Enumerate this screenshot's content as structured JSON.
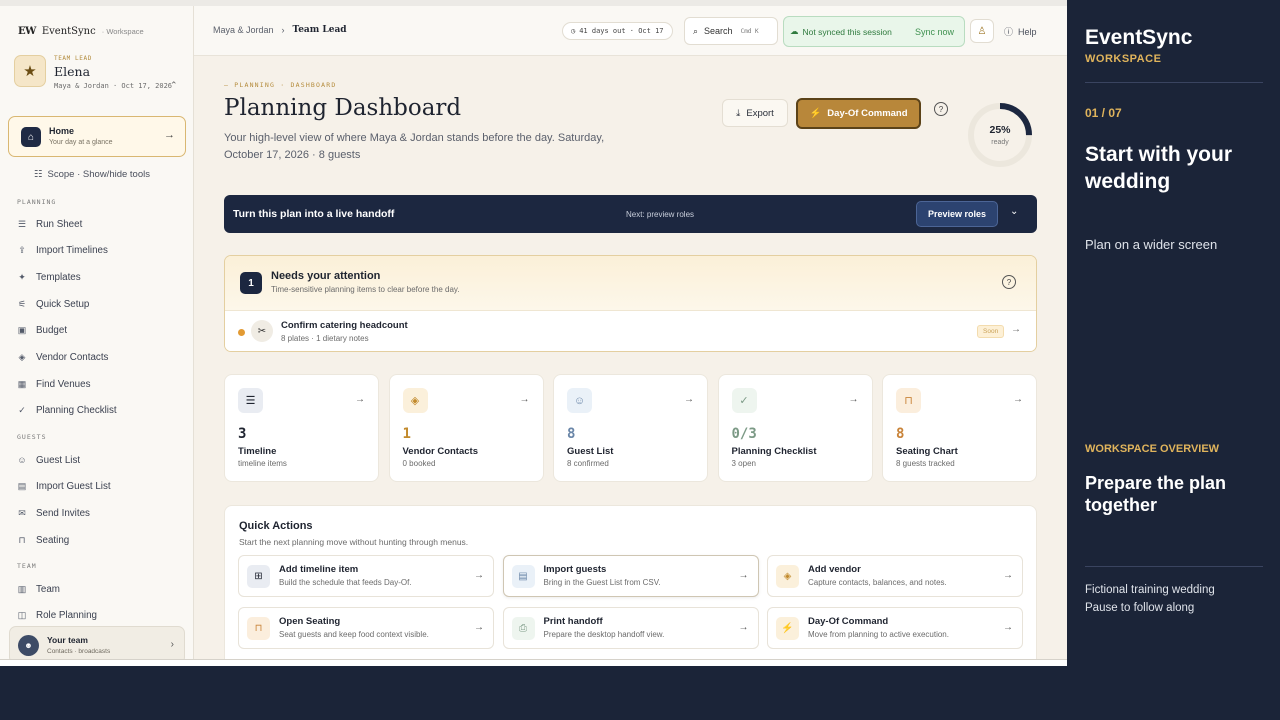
{
  "brand": {
    "logo": "EW",
    "name": "EventSync",
    "sub": "· Workspace"
  },
  "user": {
    "role": "TEAM LEAD",
    "name": "Elena",
    "meta": "Maya & Jordan · Oct 17, 2026",
    "switch_icon": "⌃"
  },
  "home": {
    "title": "Home",
    "sub": "Your day at a glance"
  },
  "scope": {
    "label": "Scope · Show/hide tools"
  },
  "sections": {
    "planning": "PLANNING",
    "guests": "GUESTS",
    "team": "TEAM"
  },
  "nav_planning": [
    {
      "label": "Run Sheet",
      "icon": "☰"
    },
    {
      "label": "Import Timelines",
      "icon": "⇪"
    },
    {
      "label": "Templates",
      "icon": "✦"
    },
    {
      "label": "Quick Setup",
      "icon": "⚟"
    },
    {
      "label": "Budget",
      "icon": "▣"
    },
    {
      "label": "Vendor Contacts",
      "icon": "◈"
    },
    {
      "label": "Find Venues",
      "icon": "▦"
    },
    {
      "label": "Planning Checklist",
      "icon": "✓"
    }
  ],
  "nav_guests": [
    {
      "label": "Guest List",
      "icon": "☺"
    },
    {
      "label": "Import Guest List",
      "icon": "▤"
    },
    {
      "label": "Send Invites",
      "icon": "✉"
    },
    {
      "label": "Seating",
      "icon": "⊓"
    }
  ],
  "nav_team": [
    {
      "label": "Team",
      "icon": "▥"
    },
    {
      "label": "Role Planning",
      "icon": "◫"
    }
  ],
  "team_card": {
    "title": "Your team",
    "sub": "Contacts · broadcasts"
  },
  "topbar": {
    "crumb_parent": "Maya & Jordan",
    "crumb_current": "Team Lead",
    "days": "41 days out · Oct 17",
    "search": "Search",
    "search_kbd": "Cmd K",
    "sync_status": "Not synced this session",
    "sync_action": "Sync now",
    "help": "Help"
  },
  "page": {
    "eyebrow": "— PLANNING · DASHBOARD",
    "title": "Planning Dashboard",
    "subtitle": "Your high-level view of where Maya & Jordan stands before the day. Saturday, October 17, 2026 · 8 guests",
    "export": "Export",
    "command": "Day-Of Command",
    "progress_pct": "25%",
    "progress_value": 25,
    "progress_label": "ready"
  },
  "handoff": {
    "title": "Turn this plan into a live handoff",
    "next": "Next: preview roles",
    "button": "Preview roles"
  },
  "attention": {
    "count": "1",
    "title": "Needs your attention",
    "sub": "Time-sensitive planning items to clear before the day.",
    "item_title": "Confirm catering headcount",
    "item_sub": "8 plates · 1 dietary notes",
    "badge": "Soon"
  },
  "stats": [
    {
      "num": "3",
      "label": "Timeline",
      "sub": "timeline items",
      "icon": "☰",
      "color": "#1f2430",
      "bg": "#e9ecf2"
    },
    {
      "num": "1",
      "label": "Vendor Contacts",
      "sub": "0 booked",
      "icon": "◈",
      "color": "#c28a2c",
      "bg": "#fbf0db"
    },
    {
      "num": "8",
      "label": "Guest List",
      "sub": "8 confirmed",
      "icon": "☺",
      "color": "#6a86a8",
      "bg": "#eaf1f8"
    },
    {
      "num": "0/3",
      "label": "Planning Checklist",
      "sub": "3 open",
      "icon": "✓",
      "color": "#7c9a86",
      "bg": "#eef5ef"
    },
    {
      "num": "8",
      "label": "Seating Chart",
      "sub": "8 guests tracked",
      "icon": "⊓",
      "color": "#c9843a",
      "bg": "#fbeedd"
    }
  ],
  "quick_actions": {
    "title": "Quick Actions",
    "sub": "Start the next planning move without hunting through menus.",
    "items": [
      {
        "name": "Add timeline item",
        "desc": "Build the schedule that feeds Day-Of.",
        "icon": "⊞",
        "bg": "#e9ecf2",
        "color": "#1f2430"
      },
      {
        "name": "Import guests",
        "desc": "Bring in the Guest List from CSV.",
        "icon": "▤",
        "bg": "#eaf1f8",
        "color": "#6a86a8"
      },
      {
        "name": "Add vendor",
        "desc": "Capture contacts, balances, and notes.",
        "icon": "◈",
        "bg": "#fbf0db",
        "color": "#c28a2c"
      },
      {
        "name": "Open Seating",
        "desc": "Seat guests and keep food context visible.",
        "icon": "⊓",
        "bg": "#fbeedd",
        "color": "#c9843a"
      },
      {
        "name": "Print handoff",
        "desc": "Prepare the desktop handoff view.",
        "icon": "⎙",
        "bg": "#eef5ef",
        "color": "#7c9a86"
      },
      {
        "name": "Day-Of Command",
        "desc": "Move from planning to active execution.",
        "icon": "⚡",
        "bg": "#fbf0db",
        "color": "#c28a2c"
      }
    ]
  },
  "overlay": {
    "brand": "EventSync",
    "brand_sub": "WORKSPACE",
    "step": "01 / 07",
    "heading": "Start with your wedding",
    "text": "Plan on a wider screen",
    "section": "WORKSPACE OVERVIEW",
    "heading2": "Prepare the plan together",
    "foot1": "Fictional training wedding",
    "foot2": "Pause to follow along"
  },
  "colors": {
    "accent": "#b8873a",
    "navy": "#1c2740",
    "sync_green": "#2f7a3e"
  }
}
